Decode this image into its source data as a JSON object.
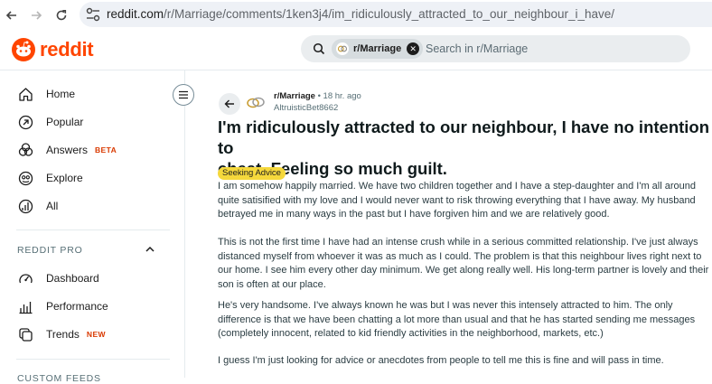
{
  "browser": {
    "url_host": "reddit.com",
    "url_path": "/r/Marriage/comments/1ken3j4/im_ridiculously_attracted_to_our_neighbour_i_have/"
  },
  "header": {
    "logo_text": "reddit",
    "search_chip": "r/Marriage",
    "search_placeholder": "Search in r/Marriage"
  },
  "sidebar": {
    "items": [
      {
        "label": "Home",
        "icon": "home-icon"
      },
      {
        "label": "Popular",
        "icon": "popular-icon"
      },
      {
        "label": "Answers",
        "badge": "BETA",
        "icon": "answers-icon"
      },
      {
        "label": "Explore",
        "icon": "explore-icon"
      },
      {
        "label": "All",
        "icon": "all-icon"
      }
    ],
    "pro_section_title": "REDDIT PRO",
    "pro_items": [
      {
        "label": "Dashboard",
        "icon": "dashboard-icon"
      },
      {
        "label": "Performance",
        "icon": "performance-icon"
      },
      {
        "label": "Trends",
        "badge": "NEW",
        "icon": "trends-icon"
      }
    ],
    "custom_feeds_title": "CUSTOM FEEDS"
  },
  "post": {
    "subreddit": "r/Marriage",
    "time": "• 18 hr. ago",
    "author": "AltruisticBet8662",
    "title_line1": "I'm ridiculously attracted to our neighbour, I have no intention to",
    "title_line2": "cheat. Feeling so much guilt.",
    "flair": "Seeking Advice",
    "paragraphs": [
      [
        "I am somehow happily married. We have two children together and I have a step-daughter and I'm all around",
        "quite satisified with my love and I would never want to risk throwing everything that I have away. My husband",
        "betrayed me in many ways in the past but I have forgiven him and we are relatively good."
      ],
      [
        "This is not the first time I have had an intense crush while in a serious committed relationship. I've just always",
        "distanced myself from whoever it was as much as I could. The problem is that this neighbour lives right next to",
        "our home. I see him every other day minimum. We get along really well. His long-term partner is lovely and their",
        "son is often at our place."
      ],
      [
        "He's very handsome. I've always known he was but I was never this intensely attracted to him. The only",
        "difference is that we have been chatting a lot more than usual and that he has started sending me messages",
        "(completely innocent, related to kid friendly activities in the neighborhood, markets, etc.)"
      ],
      [
        "I guess I'm just looking for advice or anecdotes from people to tell me this is fine and will pass in time."
      ]
    ]
  },
  "colors": {
    "reddit_orange": "#ff4500",
    "flair_yellow": "#f5d83c",
    "badge_red": "#d93900"
  }
}
